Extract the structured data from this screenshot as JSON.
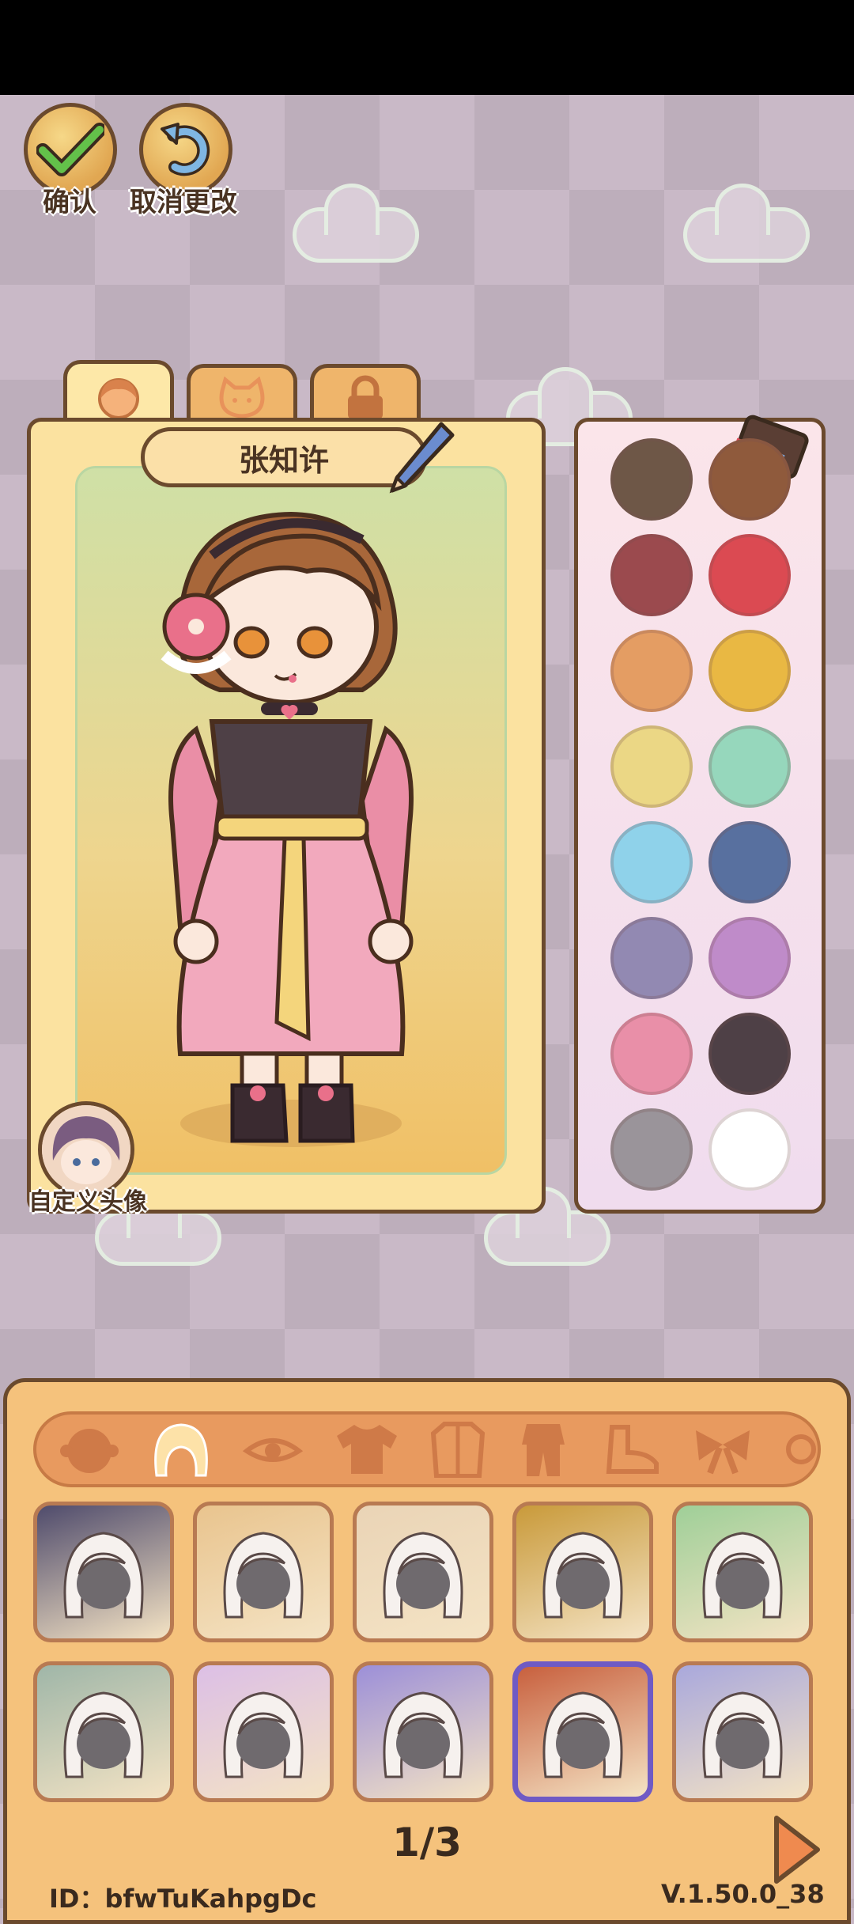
{
  "top_buttons": {
    "confirm_label": "确认",
    "cancel_label": "取消更改"
  },
  "tabs": [
    {
      "name": "character",
      "icon": "girl-face-icon",
      "active": true
    },
    {
      "name": "pet",
      "icon": "cat-face-icon",
      "active": false
    },
    {
      "name": "locked",
      "icon": "lock-icon",
      "active": false
    }
  ],
  "character": {
    "name": "张知许",
    "custom_avatar_label": "自定义头像"
  },
  "palette": {
    "colors": [
      "#6e5747",
      "#8f5a3c",
      "#9b4a4e",
      "#db4a52",
      "#e49d63",
      "#e9b843",
      "#ebd785",
      "#96d7bc",
      "#8fd2ea",
      "#58709f",
      "#9289b2",
      "#bf8bc9",
      "#e98fa8",
      "#4e4046",
      "#9a949a",
      "#ffffff"
    ]
  },
  "categories": [
    {
      "icon": "face-icon",
      "active": false
    },
    {
      "icon": "hair-icon",
      "active": true
    },
    {
      "icon": "eye-icon",
      "active": false
    },
    {
      "icon": "shirt-icon",
      "active": false
    },
    {
      "icon": "coat-icon",
      "active": false
    },
    {
      "icon": "outfit-icon",
      "active": false
    },
    {
      "icon": "shoe-icon",
      "active": false
    },
    {
      "icon": "bow-icon",
      "active": false
    },
    {
      "icon": "accessory-icon",
      "active": false
    }
  ],
  "hair_items": [
    {
      "bg": "#4f4b6c",
      "selected": false
    },
    {
      "bg": "#e9c48e",
      "selected": false
    },
    {
      "bg": "#ead4b6",
      "selected": false
    },
    {
      "bg": "#c99a3a",
      "selected": false
    },
    {
      "bg": "#9fcf98",
      "selected": false
    },
    {
      "bg": "#9fb6a8",
      "selected": false
    },
    {
      "bg": "#dcbfe6",
      "selected": false
    },
    {
      "bg": "#9c8fd8",
      "selected": false
    },
    {
      "bg": "#c8603e",
      "selected": true
    },
    {
      "bg": "#a9a8dc",
      "selected": false
    }
  ],
  "pagination": {
    "page": "1/3"
  },
  "footer": {
    "id": "ID：bfwTuKahpgDc",
    "version": "V.1.50.0_38"
  }
}
